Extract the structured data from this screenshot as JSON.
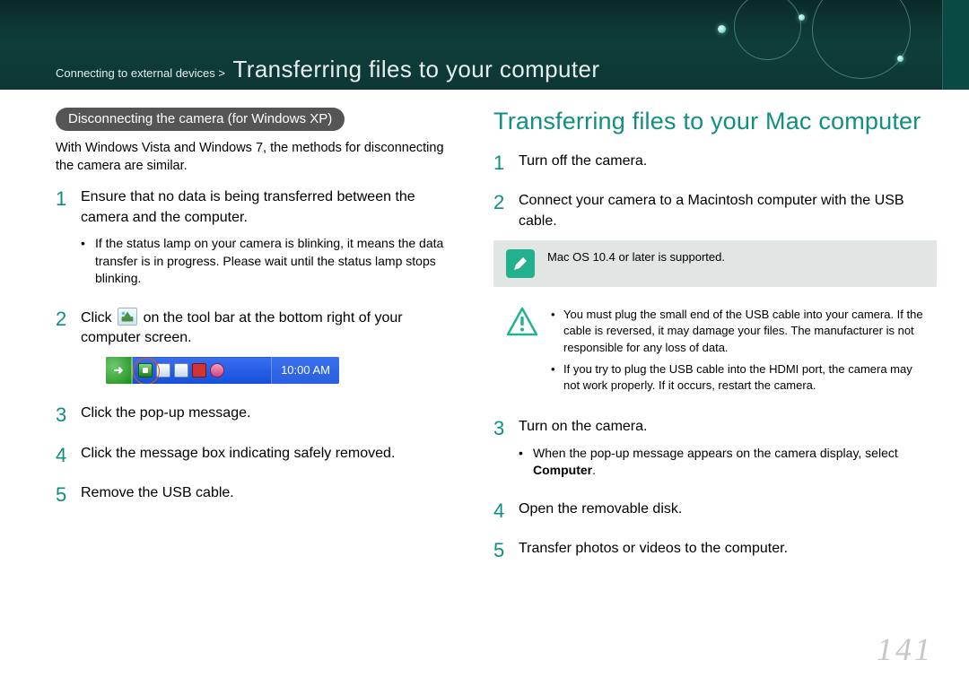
{
  "header": {
    "breadcrumb_small": "Connecting to external devices >",
    "breadcrumb_big": "Transferring files to your computer"
  },
  "left": {
    "pill": "Disconnecting the camera (for Windows XP)",
    "intro": "With Windows Vista and Windows 7, the methods for disconnecting the camera are similar.",
    "steps": [
      {
        "n": "1",
        "text": "Ensure that no data is being transferred between the camera and the computer.",
        "bullets": [
          "If the status lamp on your camera is blinking, it means the data transfer is in progress. Please wait until the status lamp stops blinking."
        ]
      },
      {
        "n": "2",
        "text_pre": "Click ",
        "text_post": " on the tool bar at the bottom right of your computer screen."
      },
      {
        "n": "3",
        "text": "Click the pop-up message."
      },
      {
        "n": "4",
        "text": "Click the message box indicating safely removed."
      },
      {
        "n": "5",
        "text": "Remove the USB cable."
      }
    ],
    "taskbar_time": "10:00 AM"
  },
  "right": {
    "title": "Transferring files to your Mac computer",
    "steps": [
      {
        "n": "1",
        "text": "Turn off the camera."
      },
      {
        "n": "2",
        "text": "Connect your camera to a Macintosh computer with the USB cable."
      },
      {
        "n": "3",
        "text": "Turn on the camera.",
        "bullets_html": "When the pop-up message appears on the camera display, select <b>Computer</b>."
      },
      {
        "n": "4",
        "text": "Open the removable disk."
      },
      {
        "n": "5",
        "text": "Transfer photos or videos to the computer."
      }
    ],
    "note": "Mac OS 10.4 or later is supported.",
    "caution": [
      "You must plug the small end of the USB cable into your camera. If the cable is reversed, it may damage your files. The manufacturer is not responsible for any loss of data.",
      "If you try to plug the USB cable into the HDMI port, the camera may not work properly. If it occurs, restart the camera."
    ]
  },
  "page_number": "141"
}
